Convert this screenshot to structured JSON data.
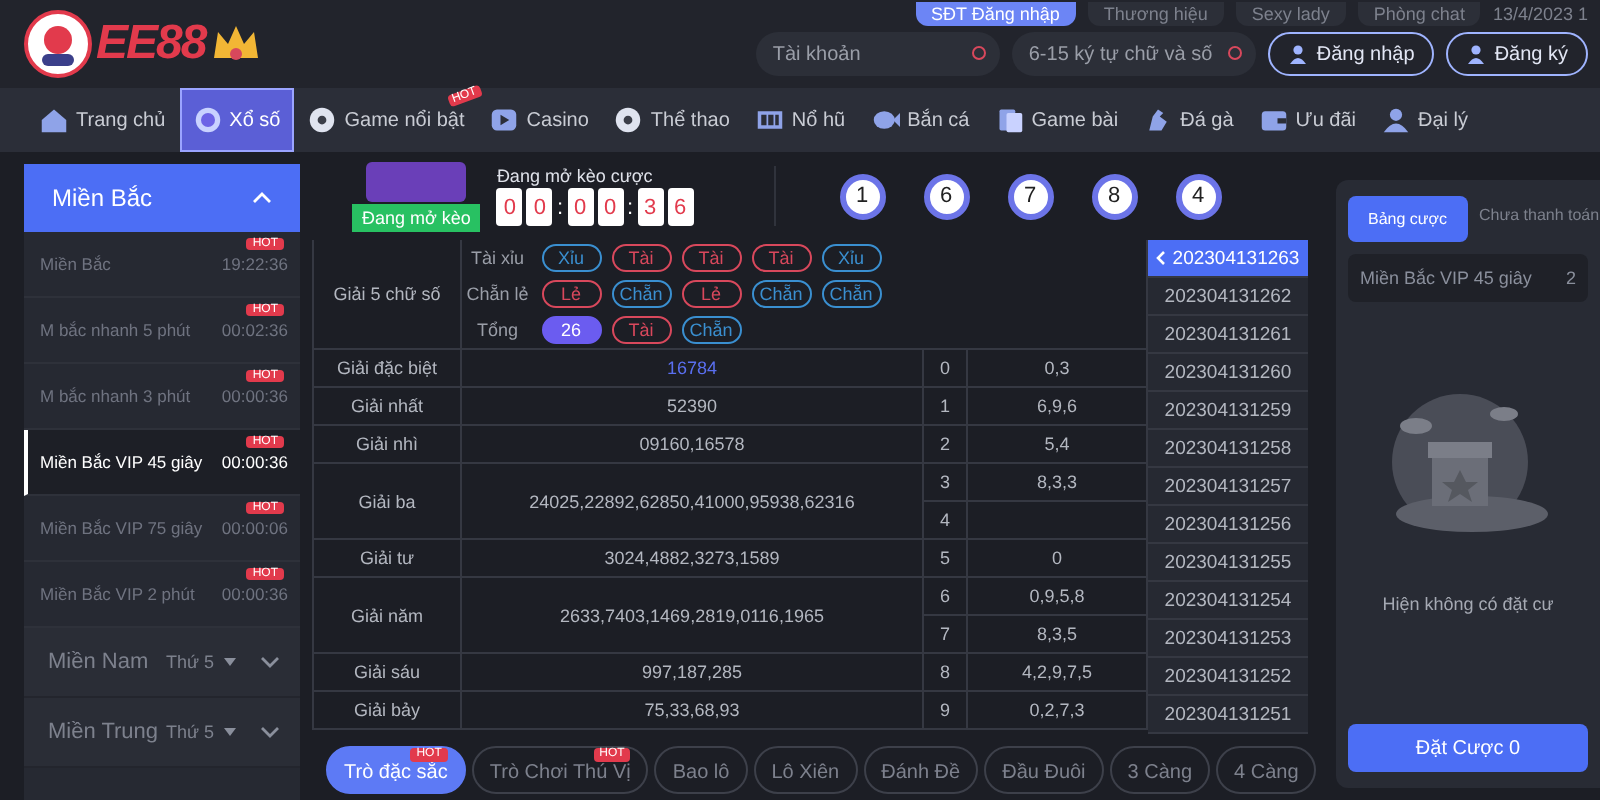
{
  "header": {
    "logo": "EE88",
    "top_links": [
      {
        "label": "SĐT Đăng nhập",
        "kind": "primary"
      },
      {
        "label": "Thương hiệu",
        "kind": "plain"
      },
      {
        "label": "Sexy lady",
        "kind": "plain"
      },
      {
        "label": "Phòng chat",
        "kind": "plain"
      }
    ],
    "date": "13/4/2023 1",
    "account_field": {
      "placeholder": "Tài khoản"
    },
    "password_field": {
      "placeholder": "6-15 ký tự chữ và số"
    },
    "buttons": [
      "Đăng nhập",
      "Đăng ký"
    ]
  },
  "nav": [
    {
      "label": "Trang chủ",
      "selected": false
    },
    {
      "label": "Xổ số",
      "selected": true
    },
    {
      "label": "Game nổi bật",
      "selected": false,
      "badge": "HOT"
    },
    {
      "label": "Casino",
      "selected": false
    },
    {
      "label": "Thể thao",
      "selected": false
    },
    {
      "label": "Nổ hũ",
      "selected": false
    },
    {
      "label": "Bắn cá",
      "selected": false
    },
    {
      "label": "Game bài",
      "selected": false
    },
    {
      "label": "Đá gà",
      "selected": false
    },
    {
      "label": "Ưu đãi",
      "selected": false
    },
    {
      "label": "Đại lý",
      "selected": false
    }
  ],
  "sidebar": {
    "group": {
      "title": "Miền Bắc",
      "expanded": true
    },
    "items": [
      {
        "name": "Miền Bắc",
        "time": "19:22:36",
        "badge": "HOT",
        "selected": false
      },
      {
        "name": "M bắc nhanh 5 phút",
        "time": "00:02:36",
        "badge": "HOT",
        "selected": false
      },
      {
        "name": "M bắc nhanh 3 phút",
        "time": "00:00:36",
        "badge": "HOT",
        "selected": false
      },
      {
        "name": "Miền Bắc VIP 45 giây",
        "time": "00:00:36",
        "badge": "HOT",
        "selected": true
      },
      {
        "name": "Miền Bắc VIP 75 giây",
        "time": "00:00:06",
        "badge": "HOT",
        "selected": false
      },
      {
        "name": "Miền Bắc VIP 2 phút",
        "time": "00:00:36",
        "badge": "HOT",
        "selected": false
      }
    ],
    "groups": [
      {
        "title": "Miền Nam",
        "day": "Thứ 5",
        "expanded": false
      },
      {
        "title": "Miền Trung",
        "day": "Thứ 5",
        "expanded": false
      }
    ]
  },
  "game": {
    "status_button": "Đang mở kèo",
    "status_label": "Đang mở kèo cược",
    "countdown": [
      {
        "kind": "digit",
        "text": "0"
      },
      {
        "kind": "digit",
        "text": "0"
      },
      {
        "kind": "sep",
        "text": ":"
      },
      {
        "kind": "digit",
        "text": "0"
      },
      {
        "kind": "digit",
        "text": "0"
      },
      {
        "kind": "sep",
        "text": ":"
      },
      {
        "kind": "digit",
        "text": "3"
      },
      {
        "kind": "digit",
        "text": "6"
      }
    ],
    "balls": [
      "1",
      "6",
      "7",
      "8",
      "4"
    ]
  },
  "five_digit": {
    "name": "Giải 5 chữ số",
    "rows": [
      {
        "label": "Tài xỉu",
        "chips": [
          {
            "text": "Xỉu",
            "kind": "outline",
            "color": "#3a8fd0"
          },
          {
            "text": "Tài",
            "kind": "outline",
            "color": "#d8485c"
          },
          {
            "text": "Tài",
            "kind": "outline",
            "color": "#d8485c"
          },
          {
            "text": "Tài",
            "kind": "outline",
            "color": "#d8485c"
          },
          {
            "text": "Xỉu",
            "kind": "outline",
            "color": "#3a8fd0"
          }
        ]
      },
      {
        "label": "Chẵn lẻ",
        "chips": [
          {
            "text": "Lẻ",
            "kind": "outline",
            "color": "#d8485c"
          },
          {
            "text": "Chẵn",
            "kind": "outline",
            "color": "#3a8fd0"
          },
          {
            "text": "Lẻ",
            "kind": "outline",
            "color": "#d8485c"
          },
          {
            "text": "Chẵn",
            "kind": "outline",
            "color": "#3a8fd0"
          },
          {
            "text": "Chẵn",
            "kind": "outline",
            "color": "#3a8fd0"
          }
        ]
      },
      {
        "label": "Tổng",
        "chips": [
          {
            "text": "26",
            "kind": "filled",
            "color": "#6b5cf0"
          },
          {
            "text": "Tài",
            "kind": "outline",
            "color": "#d8485c"
          },
          {
            "text": "Chẵn",
            "kind": "outline",
            "color": "#3a8fd0"
          }
        ]
      }
    ]
  },
  "prizes": [
    {
      "name": "Giải đặc biệt",
      "numbers": "16784",
      "highlight": true,
      "digits": [
        {
          "digit": "0",
          "values": "0,3"
        }
      ]
    },
    {
      "name": "Giải nhất",
      "numbers": "52390",
      "highlight": false,
      "digits": [
        {
          "digit": "1",
          "values": "6,9,6"
        }
      ]
    },
    {
      "name": "Giải nhì",
      "numbers": "09160,16578",
      "highlight": false,
      "digits": [
        {
          "digit": "2",
          "values": "5,4"
        }
      ]
    },
    {
      "name": "Giải ba",
      "numbers": "24025,22892,62850,41000,95938,62316",
      "highlight": false,
      "digits": [
        {
          "digit": "3",
          "values": "8,3,3"
        },
        {
          "digit": "4"
        }
      ]
    },
    {
      "name": "Giải tư",
      "numbers": "3024,4882,3273,1589",
      "highlight": false,
      "digits": [
        {
          "digit": "5",
          "values": "0"
        }
      ]
    },
    {
      "name": "Giải năm",
      "numbers": "2633,7403,1469,2819,0116,1965",
      "highlight": false,
      "digits": [
        {
          "digit": "6",
          "values": "0,9,5,8"
        },
        {
          "digit": "7",
          "values": "8,3,5"
        }
      ]
    },
    {
      "name": "Giải sáu",
      "numbers": "997,187,285",
      "highlight": false,
      "digits": [
        {
          "digit": "8",
          "values": "4,2,9,7,5"
        }
      ]
    },
    {
      "name": "Giải bảy",
      "numbers": "75,33,68,93",
      "highlight": false,
      "digits": [
        {
          "digit": "9",
          "values": "0,2,7,3"
        }
      ]
    }
  ],
  "periods": [
    {
      "id": "202304131263",
      "selected": true
    },
    {
      "id": "202304131262",
      "selected": false
    },
    {
      "id": "202304131261",
      "selected": false
    },
    {
      "id": "202304131260",
      "selected": false
    },
    {
      "id": "202304131259",
      "selected": false
    },
    {
      "id": "202304131258",
      "selected": false
    },
    {
      "id": "202304131257",
      "selected": false
    },
    {
      "id": "202304131256",
      "selected": false
    },
    {
      "id": "202304131255",
      "selected": false
    },
    {
      "id": "202304131254",
      "selected": false
    },
    {
      "id": "202304131253",
      "selected": false
    },
    {
      "id": "202304131252",
      "selected": false
    },
    {
      "id": "202304131251",
      "selected": false
    }
  ],
  "bet_tabs": [
    {
      "label": "Trò đặc sắc",
      "selected": true,
      "badge": "HOT"
    },
    {
      "label": "Trò Chơi Thú Vị",
      "selected": false,
      "badge": "HOT"
    },
    {
      "label": "Bao lô",
      "selected": false
    },
    {
      "label": "Lô Xiên",
      "selected": false
    },
    {
      "label": "Đánh Đề",
      "selected": false
    },
    {
      "label": "Đầu Đuôi",
      "selected": false
    },
    {
      "label": "3 Càng",
      "selected": false
    },
    {
      "label": "4 Càng",
      "selected": false
    }
  ],
  "bet_panel": {
    "tabs": [
      {
        "label": "Bảng cược",
        "selected": true
      },
      {
        "label": "Chưa thanh toán",
        "selected": false
      }
    ],
    "game": "Miền Bắc VIP 45 giây",
    "count": "2",
    "empty_text": "Hiện không có đặt cư",
    "submit": "Đặt Cược 0"
  }
}
